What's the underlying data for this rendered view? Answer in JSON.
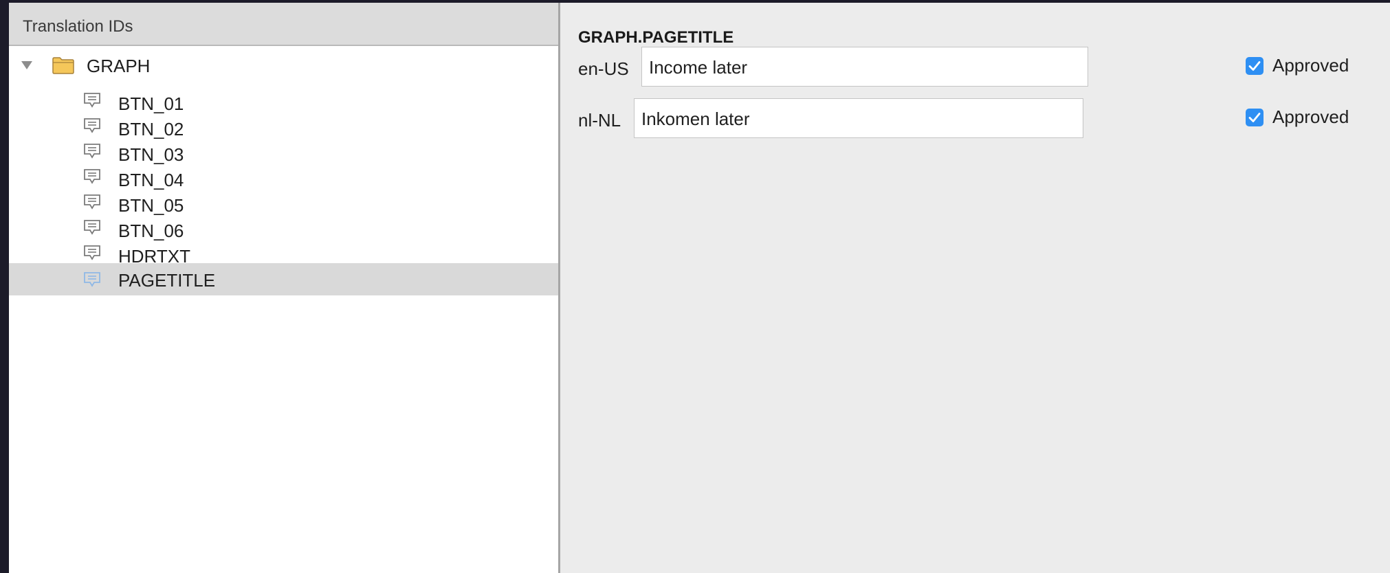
{
  "sidebar": {
    "header": "Translation IDs",
    "root": {
      "label": "GRAPH",
      "icon": "folder-icon",
      "expanded": true
    },
    "items": [
      {
        "label": "BTN_01",
        "icon": "message-icon",
        "selected": false
      },
      {
        "label": "BTN_02",
        "icon": "message-icon",
        "selected": false
      },
      {
        "label": "BTN_03",
        "icon": "message-icon",
        "selected": false
      },
      {
        "label": "BTN_04",
        "icon": "message-icon",
        "selected": false
      },
      {
        "label": "BTN_05",
        "icon": "message-icon",
        "selected": false
      },
      {
        "label": "BTN_06",
        "icon": "message-icon",
        "selected": false
      },
      {
        "label": "HDRTXT",
        "icon": "message-icon",
        "selected": false
      },
      {
        "label": "PAGETITLE",
        "icon": "message-icon",
        "selected": true
      }
    ]
  },
  "detail": {
    "title": "GRAPH.PAGETITLE",
    "translations": [
      {
        "locale": "en-US",
        "value": "Income later",
        "approved": true,
        "approved_label": "Approved"
      },
      {
        "locale": "nl-NL",
        "value": "Inkomen later",
        "approved": true,
        "approved_label": "Approved"
      }
    ]
  },
  "colors": {
    "accent": "#2e8ff3",
    "folder": "#f5c75a",
    "selection": "#d9d9d9",
    "background": "#1c1b29"
  }
}
